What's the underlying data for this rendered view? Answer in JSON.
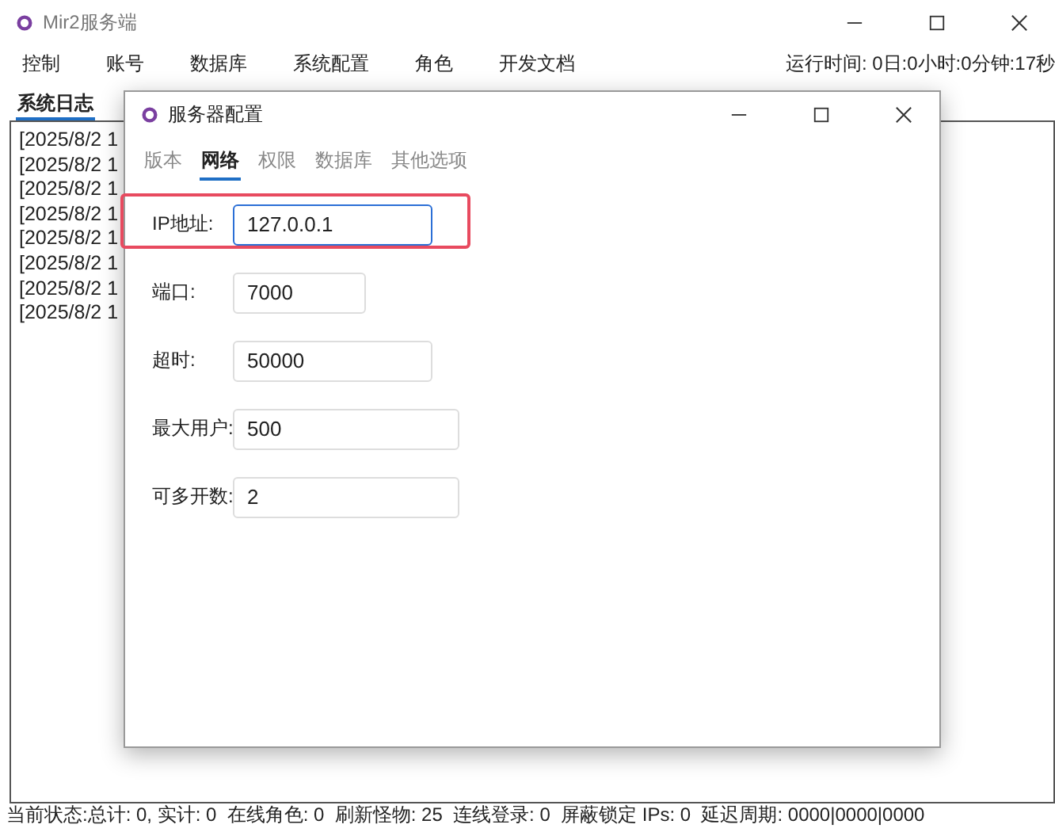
{
  "window": {
    "title": "Mir2服务端"
  },
  "menu": [
    "控制",
    "账号",
    "数据库",
    "系统配置",
    "角色",
    "开发文档"
  ],
  "runtime": "运行时间: 0日:0小时:0分钟:17秒",
  "tabs": [
    {
      "label": "系统日志",
      "selected": true
    }
  ],
  "log_lines": [
    "[2025/8/2 1",
    "[2025/8/2 1",
    "[2025/8/2 1",
    "[2025/8/2 1",
    "[2025/8/2 1",
    "[2025/8/2 1",
    "[2025/8/2 1",
    "[2025/8/2 1"
  ],
  "dialog": {
    "title": "服务器配置",
    "tabs": [
      {
        "label": "版本",
        "selected": false
      },
      {
        "label": "网络",
        "selected": true
      },
      {
        "label": "权限",
        "selected": false
      },
      {
        "label": "数据库",
        "selected": false
      },
      {
        "label": "其他选项",
        "selected": false
      }
    ],
    "fields": [
      {
        "label": "IP地址:",
        "value": "127.0.0.1",
        "focused": true,
        "highlighted": true
      },
      {
        "label": "端口:",
        "value": "7000",
        "focused": false,
        "highlighted": false
      },
      {
        "label": "超时:",
        "value": "50000",
        "focused": false,
        "highlighted": false
      },
      {
        "label": "最大用户:",
        "value": "500",
        "focused": false,
        "highlighted": false
      },
      {
        "label": "可多开数:",
        "value": "2",
        "focused": false,
        "highlighted": false
      }
    ]
  },
  "status_bar": "当前状态:总计: 0, 实计: 0  在线角色: 0  刷新怪物: 25  连线登录: 0  屏蔽锁定 IPs: 0  延迟周期: 0000|0000|0000"
}
